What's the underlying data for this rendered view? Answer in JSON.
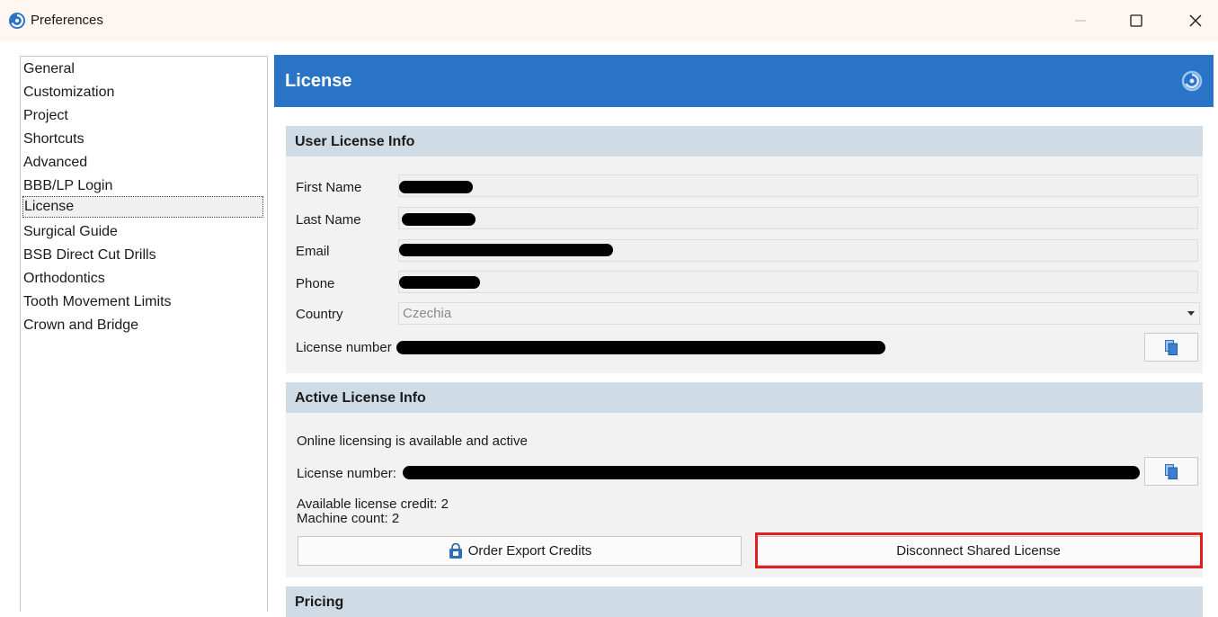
{
  "window": {
    "title": "Preferences"
  },
  "nav": {
    "items": [
      {
        "label": "General"
      },
      {
        "label": "Customization"
      },
      {
        "label": "Project"
      },
      {
        "label": "Shortcuts"
      },
      {
        "label": "Advanced"
      },
      {
        "label": "BBB/LP Login"
      },
      {
        "label": "License",
        "selected": true
      },
      {
        "label": "Surgical Guide"
      },
      {
        "label": "BSB Direct Cut Drills"
      },
      {
        "label": "Orthodontics"
      },
      {
        "label": "Tooth Movement Limits"
      },
      {
        "label": "Crown and Bridge"
      }
    ]
  },
  "header": {
    "title": "License",
    "accent_color": "#2a74c7"
  },
  "user_license": {
    "title": "User License Info",
    "first_name_label": "First Name",
    "last_name_label": "Last Name",
    "email_label": "Email",
    "phone_label": "Phone",
    "country_label": "Country",
    "country_value": "Czechia",
    "license_number_label": "License number"
  },
  "active_license": {
    "title": "Active License Info",
    "status": "Online licensing is available and active",
    "license_number_label": "License number:",
    "credit": "Available license credit: 2",
    "machines": "Machine count: 2",
    "order_button": "Order Export Credits",
    "disconnect_button": "Disconnect Shared License",
    "highlight_color": "#e02020"
  },
  "pricing": {
    "title": "Pricing"
  }
}
